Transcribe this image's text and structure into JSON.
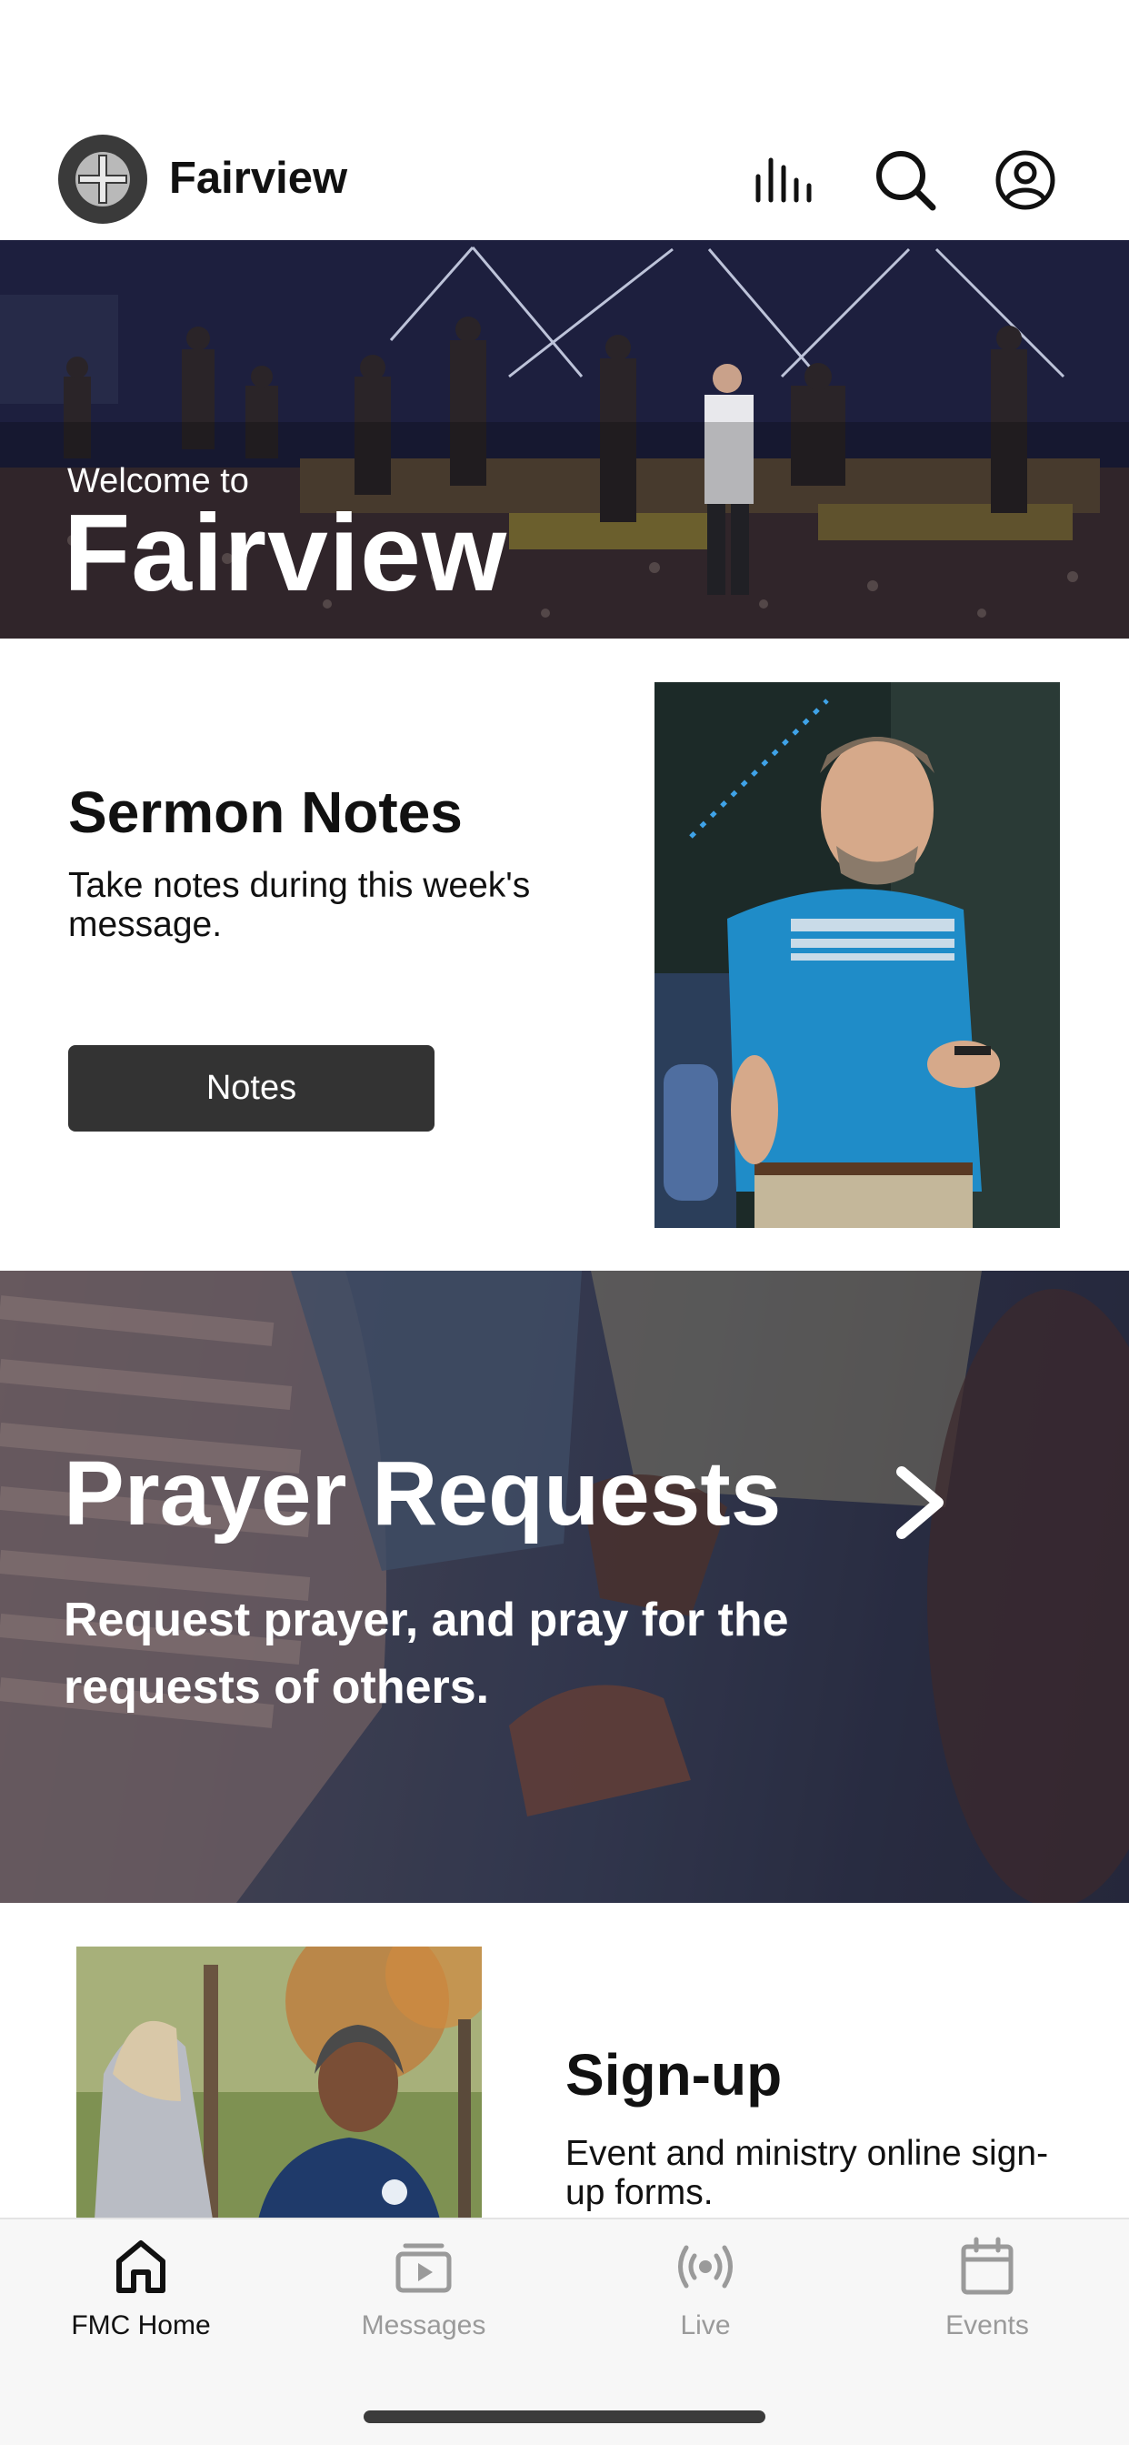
{
  "header": {
    "app_title": "Fairview",
    "icons": [
      "logo-cross-icon",
      "equalizer-icon",
      "search-icon",
      "profile-icon"
    ]
  },
  "hero": {
    "welcome": "Welcome to",
    "title": "Fairview"
  },
  "sermon": {
    "title": "Sermon Notes",
    "description": "Take notes during this week's message.",
    "button_label": "Notes"
  },
  "prayer": {
    "title": "Prayer Requests",
    "description": "Request prayer, and pray for the requests of others."
  },
  "signup": {
    "title": "Sign-up",
    "description": "Event and ministry online sign-up forms."
  },
  "tabs": [
    {
      "label": "FMC Home",
      "icon": "home-icon",
      "active": true
    },
    {
      "label": "Messages",
      "icon": "messages-icon",
      "active": false
    },
    {
      "label": "Live",
      "icon": "broadcast-icon",
      "active": false
    },
    {
      "label": "Events",
      "icon": "calendar-icon",
      "active": false
    }
  ],
  "colors": {
    "button_bg": "#333333",
    "tab_active": "#111111",
    "tab_inactive": "#9a9a9a"
  }
}
